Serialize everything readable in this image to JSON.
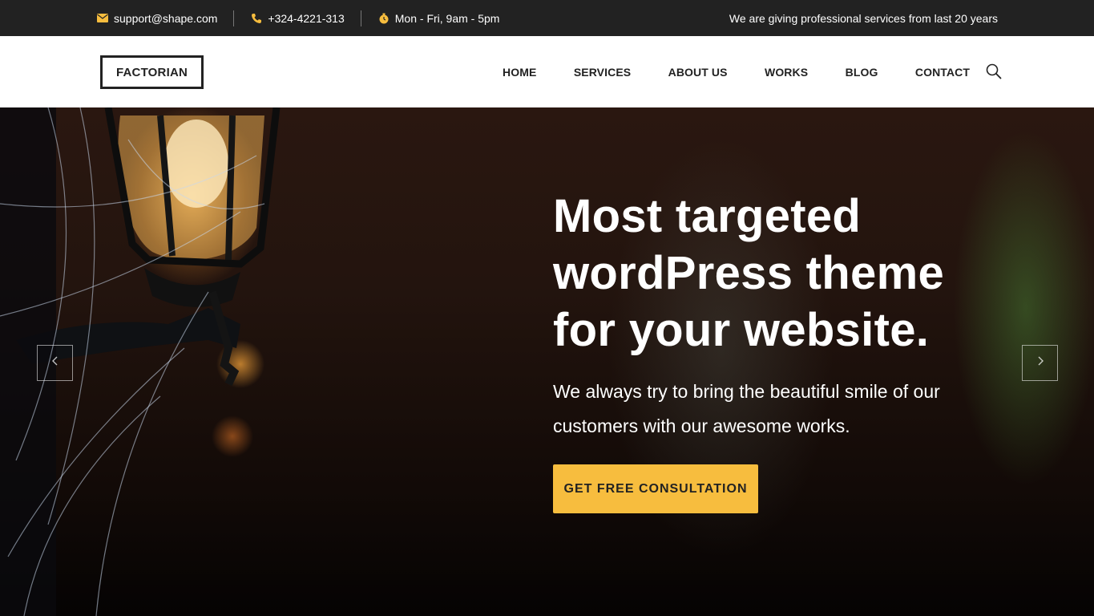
{
  "topbar": {
    "email": "support@shape.com",
    "phone": "+324-4221-313",
    "hours": "Mon - Fri, 9am - 5pm",
    "tagline": "We are giving professional services from last 20 years",
    "icons": [
      "mail-icon",
      "phone-icon",
      "clock-icon"
    ]
  },
  "header": {
    "logo": "FACTORIAN",
    "nav": [
      "HOME",
      "SERVICES",
      "ABOUT US",
      "WORKS",
      "BLOG",
      "CONTACT"
    ],
    "search_icon": "search-icon"
  },
  "hero": {
    "title_line1": "Most targeted",
    "title_line2": "wordPress theme",
    "title_line3": "for your website.",
    "subtitle_line1": "We always try to bring the beautiful smile of our",
    "subtitle_line2": "customers with our awesome works.",
    "cta": "GET FREE CONSULTATION",
    "prev_icon": "chevron-left-icon",
    "next_icon": "chevron-right-icon"
  },
  "colors": {
    "topbar_bg": "#222222",
    "accent": "#f7bd3e",
    "icon_accent": "#f7bd3e",
    "text_dark": "#222222"
  }
}
